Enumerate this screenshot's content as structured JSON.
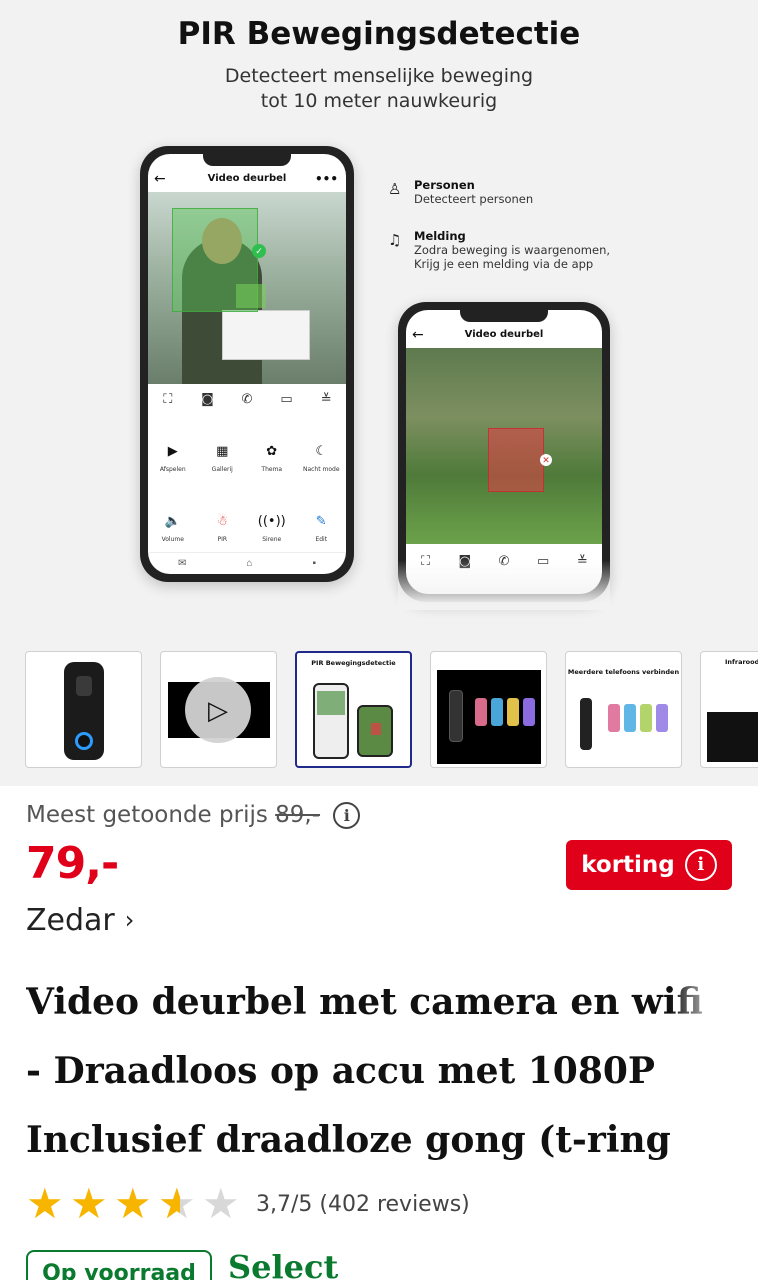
{
  "hero": {
    "title": "PIR Bewegingsdetectie",
    "subtitle": "Detecteert menselijke beweging\ntot 10 meter nauwkeurig",
    "phone_primary": {
      "app_title": "Video deurbel",
      "controls": [
        "scan-icon",
        "camera-icon",
        "phone-icon",
        "video-icon",
        "collapse-icon"
      ],
      "grid_rows": [
        [
          {
            "label": "Afspelen",
            "icon": "▶"
          },
          {
            "label": "Gallerij",
            "icon": "▦"
          },
          {
            "label": "Thema",
            "icon": "✿"
          },
          {
            "label": "Nacht mode",
            "icon": "☾"
          }
        ],
        [
          {
            "label": "Volume",
            "icon": "🔈"
          },
          {
            "label": "PIR",
            "icon": "☃"
          },
          {
            "label": "Sirene",
            "icon": "((•))"
          },
          {
            "label": "Edit",
            "icon": "✎"
          }
        ]
      ]
    },
    "features": [
      {
        "heading": "Personen",
        "description": "Detecteert personen",
        "icon": "person-icon"
      },
      {
        "heading": "Melding",
        "description": "Zodra beweging is waargenomen,\nKrijg je een melding via de app",
        "icon": "bell-icon"
      }
    ],
    "phone_secondary": {
      "app_title": "Video deurbel"
    }
  },
  "thumbnails": [
    {
      "caption": "",
      "selected": false
    },
    {
      "caption": "",
      "selected": false
    },
    {
      "caption": "PIR Bewegingsdetectie",
      "selected": true
    },
    {
      "caption": "Meerdere telefoons verbinden",
      "selected": false
    },
    {
      "caption": "Meerdere telefoons verbinden",
      "selected": false
    },
    {
      "caption": "Infrarood",
      "selected": false
    }
  ],
  "product": {
    "price_note_label": "Meest getoonde prijs",
    "price_note_old": "89,-",
    "price": "79,-",
    "discount_label": "korting",
    "brand": "Zedar",
    "title_lines": [
      "Video deurbel met camera en wifi",
      "- Draadloos op accu met 1080P",
      "Inclusief draadloze gong (t-ring"
    ],
    "rating_value": 3.7,
    "rating_text": "3,7/5 (402 reviews)",
    "stock_label": "Op voorraad",
    "select_label": "Select"
  },
  "colors": {
    "price_red": "#e0001a",
    "stock_green": "#0a7a2f",
    "star_gold": "#f7b500",
    "thumb_selected_border": "#1f2a8a"
  }
}
